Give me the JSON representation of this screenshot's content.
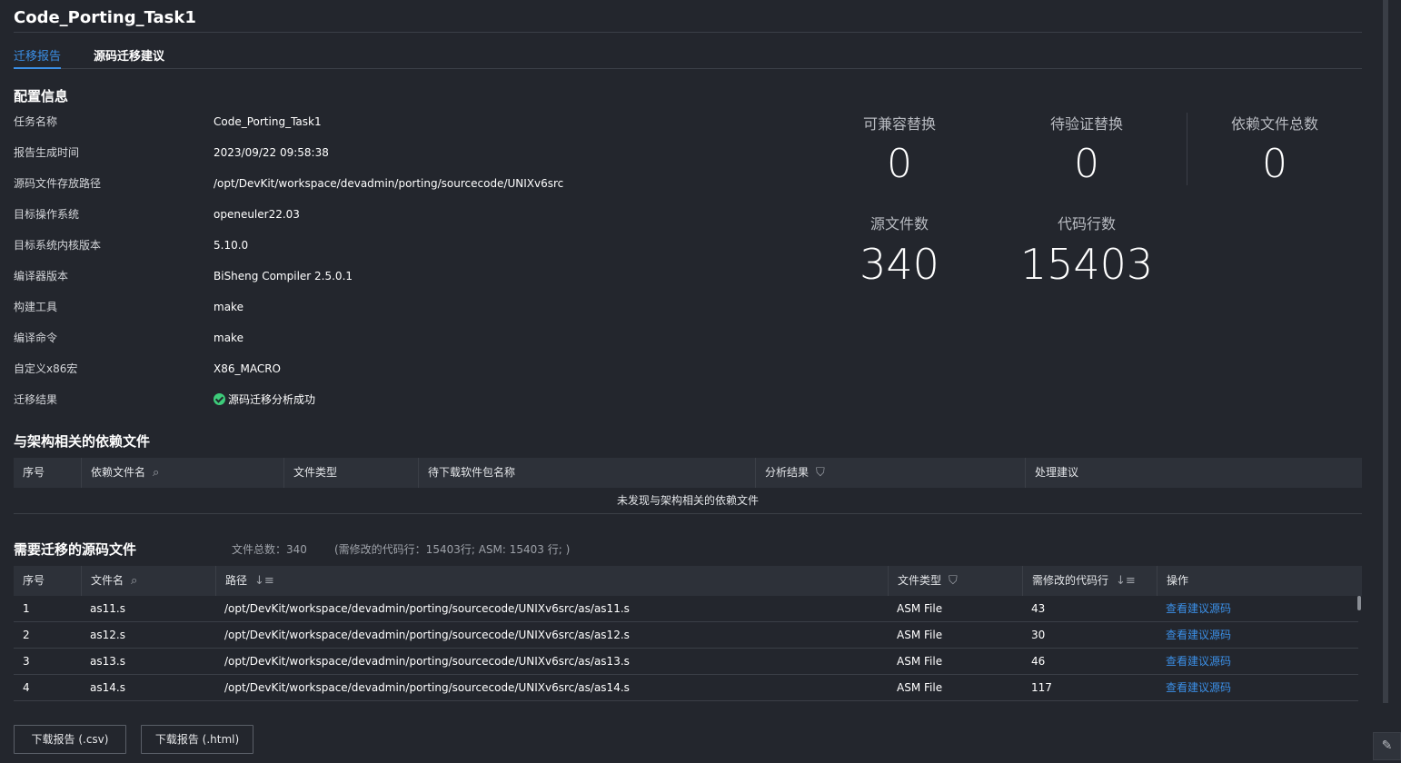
{
  "header": {
    "title": "Code_Porting_Task1"
  },
  "tabs": [
    {
      "label": "迁移报告",
      "active": true
    },
    {
      "label": "源码迁移建议",
      "active": false
    }
  ],
  "config": {
    "title": "配置信息",
    "rows": [
      {
        "key": "任务名称",
        "value": "Code_Porting_Task1"
      },
      {
        "key": "报告生成时间",
        "value": "2023/09/22 09:58:38"
      },
      {
        "key": "源码文件存放路径",
        "value": "/opt/DevKit/workspace/devadmin/porting/sourcecode/UNIXv6src"
      },
      {
        "key": "目标操作系统",
        "value": "openeuler22.03"
      },
      {
        "key": "目标系统内核版本",
        "value": "5.10.0"
      },
      {
        "key": "编译器版本",
        "value": "BiSheng Compiler 2.5.0.1"
      },
      {
        "key": "构建工具",
        "value": "make"
      },
      {
        "key": "编译命令",
        "value": "make"
      },
      {
        "key": "自定义x86宏",
        "value": "X86_MACRO"
      },
      {
        "key": "迁移结果",
        "value": "源码迁移分析成功"
      }
    ]
  },
  "stats": {
    "compatible": {
      "label": "可兼容替换",
      "value": "0"
    },
    "pending": {
      "label": "待验证替换",
      "value": "0"
    },
    "deps_total": {
      "label": "依赖文件总数",
      "value": "0"
    },
    "source_files": {
      "label": "源文件数",
      "value": "340"
    },
    "code_lines": {
      "label": "代码行数",
      "value": "15403"
    }
  },
  "deps": {
    "title": "与架构相关的依赖文件",
    "columns": [
      "序号",
      "依赖文件名",
      "文件类型",
      "待下载软件包名称",
      "分析结果",
      "处理建议"
    ],
    "empty": "未发现与架构相关的依赖文件"
  },
  "sources": {
    "title": "需要迁移的源码文件",
    "total": "文件总数：340",
    "detail": "(需修改的代码行：15403行; ASM: 15403 行; )",
    "columns": [
      "序号",
      "文件名",
      "路径",
      "文件类型",
      "需修改的代码行",
      "操作"
    ],
    "rows": [
      {
        "idx": "1",
        "name": "as11.s",
        "path": "/opt/DevKit/workspace/devadmin/porting/sourcecode/UNIXv6src/as/as11.s",
        "type": "ASM File",
        "lines": "43",
        "action": "查看建议源码"
      },
      {
        "idx": "2",
        "name": "as12.s",
        "path": "/opt/DevKit/workspace/devadmin/porting/sourcecode/UNIXv6src/as/as12.s",
        "type": "ASM File",
        "lines": "30",
        "action": "查看建议源码"
      },
      {
        "idx": "3",
        "name": "as13.s",
        "path": "/opt/DevKit/workspace/devadmin/porting/sourcecode/UNIXv6src/as/as13.s",
        "type": "ASM File",
        "lines": "46",
        "action": "查看建议源码"
      },
      {
        "idx": "4",
        "name": "as14.s",
        "path": "/opt/DevKit/workspace/devadmin/porting/sourcecode/UNIXv6src/as/as14.s",
        "type": "ASM File",
        "lines": "117",
        "action": "查看建议源码"
      }
    ]
  },
  "buttons": {
    "csv": "下载报告 (.csv)",
    "html": "下载报告 (.html)"
  },
  "icons": {
    "search": "⌕",
    "filter": "⛉",
    "sort": "↓≡",
    "edit": "✎"
  }
}
